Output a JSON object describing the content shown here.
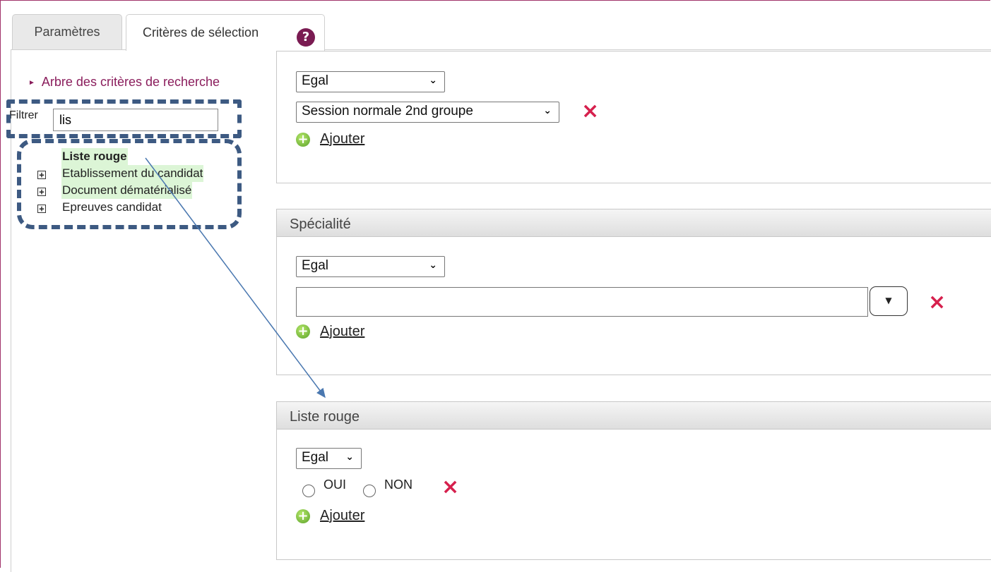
{
  "tabs": {
    "parametres": "Paramètres",
    "criteres": "Critères de sélection",
    "help": "?"
  },
  "tree": {
    "title": "Arbre des critères de recherche",
    "filter_label": "Filtrer",
    "filter_value": "lis",
    "items": [
      {
        "label": "Liste rouge",
        "expandable": false,
        "highlight": true,
        "bold": true
      },
      {
        "label": "Etablissement du candidat",
        "expandable": true,
        "highlight": true,
        "bold": false
      },
      {
        "label": "Document dématérialisé",
        "expandable": true,
        "highlight": true,
        "bold": false
      },
      {
        "label": "Epreuves candidat",
        "expandable": true,
        "highlight": false,
        "bold": false
      }
    ],
    "expand_glyph": "+"
  },
  "panel1": {
    "operator": "Egal",
    "value": "Session normale 2nd groupe",
    "add_label": "Ajouter"
  },
  "panel2": {
    "title": "Spécialité",
    "operator": "Egal",
    "value": "",
    "add_label": "Ajouter"
  },
  "panel3": {
    "title": "Liste rouge",
    "operator": "Egal",
    "options": [
      "OUI",
      "NON"
    ],
    "add_label": "Ajouter"
  },
  "icons": {
    "remove": "×",
    "add": "+",
    "dropdown": "⌄",
    "combo": "▼",
    "tree_bullet": "►"
  },
  "colors": {
    "accent": "#8a1d5c",
    "remove": "#d6204d",
    "highlight": "#dcf5d6",
    "annotation": "#3d5a82",
    "arrow": "#4a78b0"
  }
}
